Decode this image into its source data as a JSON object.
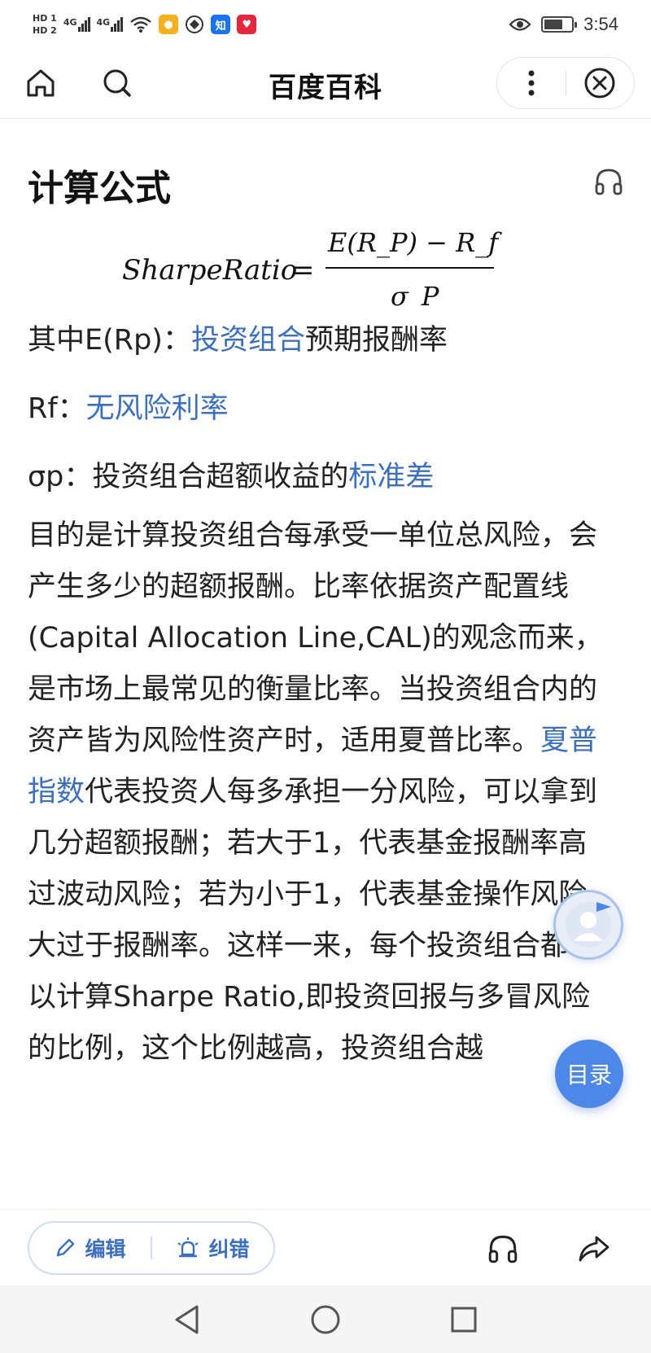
{
  "status_bar": {
    "hd1": "HD 1",
    "hd2": "HD 2",
    "net1": "4G",
    "net2": "4G",
    "time": "3:54",
    "icons": [
      "hd-icon",
      "signal-icon",
      "wifi-icon",
      "app-icon",
      "browser-icon",
      "zhihu-icon",
      "huawei-icon",
      "eye-icon",
      "battery-icon"
    ]
  },
  "header": {
    "title": "百度百科",
    "home_icon": "home-icon",
    "search_icon": "search-icon",
    "more_icon": "more-vertical-icon",
    "close_icon": "close-icon"
  },
  "content": {
    "section_title": "计算公式",
    "listen_icon": "headphones-icon",
    "formula": {
      "lhs": "SharpeRatio",
      "eq": "=",
      "numerator": "E(R_P) − R_f",
      "denominator": "σ_P"
    },
    "line1": {
      "prefix": "其中E(Rp)：",
      "link": "投资组合",
      "suffix": "预期报酬率"
    },
    "line2": {
      "prefix": "Rf：",
      "link": "无风险利率"
    },
    "line3": {
      "prefix": "σp：投资组合超额收益的",
      "link": "标准差"
    },
    "paragraph": {
      "part1": "目的是计算投资组合每承受一单位总风险，会产生多少的超额报酬。比率依据资产配置线(Capital Allocation Line,CAL)的观念而来，是市场上最常见的衡量比率。当投资组合内的资产皆为风险性资产时，适用夏普比率。",
      "link": "夏普指数",
      "part2": "代表投资人每多承担一分风险，可以拿到几分超额报酬；若大于1，代表基金报酬率高过波动风险；若为小于1，代表基金操作风险大过于报酬率。这样一来，每个投资组合都可以计算Sharpe Ratio,即投资回报与多冒风险的比例，这个比例越高，投资组合越"
    }
  },
  "floating": {
    "toc_label": "目录",
    "avatar_icon": "user-avatar-icon"
  },
  "toolbar": {
    "edit_label": "编辑",
    "report_label": "纠错",
    "edit_icon": "pencil-icon",
    "report_icon": "alarm-icon",
    "listen_icon": "headphones-icon",
    "share_icon": "share-icon"
  },
  "navbar": {
    "icons": [
      "back-triangle-icon",
      "home-circle-icon",
      "recents-square-icon"
    ]
  }
}
